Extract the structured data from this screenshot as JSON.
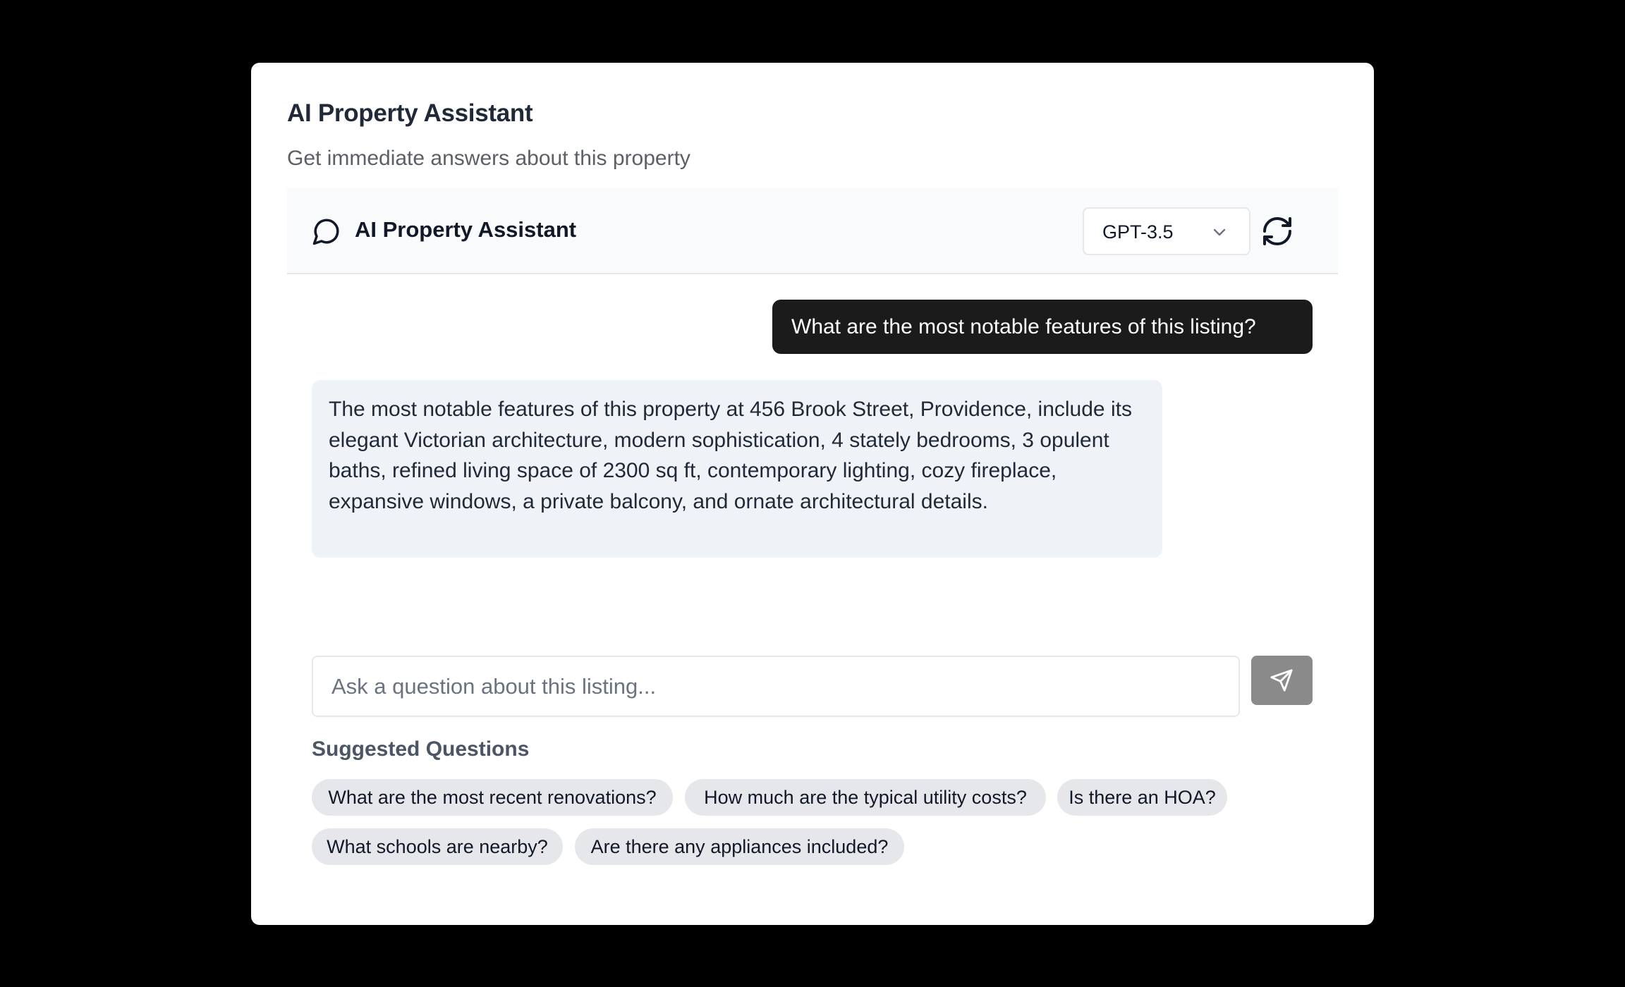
{
  "card": {
    "title": "AI Property Assistant",
    "subtitle": "Get immediate answers about this property"
  },
  "chat_header": {
    "title": "AI Property Assistant",
    "icon": "chat-bubble-icon",
    "model_select": {
      "selected": "GPT-3.5",
      "icon": "chevron-down-icon"
    },
    "refresh_icon": "refresh-icon"
  },
  "messages": [
    {
      "role": "user",
      "text": "What are the most notable features of this listing?"
    },
    {
      "role": "assistant",
      "text": "The most notable features of this property at 456 Brook Street, Providence, include its elegant Victorian architecture, modern sophistication, 4 stately bedrooms, 3 opulent baths, refined living space of 2300 sq ft, contemporary lighting, cozy fireplace, expansive windows, a private balcony, and ornate architectural details."
    }
  ],
  "composer": {
    "placeholder": "Ask a question about this listing...",
    "value": "",
    "send_icon": "send-icon"
  },
  "suggestions": {
    "title": "Suggested Questions",
    "items": [
      "What are the most recent renovations?",
      "How much are the typical utility costs?",
      "Is there an HOA?",
      "What schools are nearby?",
      "Are there any appliances included?"
    ]
  },
  "colors": {
    "page_background": "#000000",
    "card_background": "#ffffff",
    "user_bubble": "#1b1b1b",
    "assistant_bubble": "#eff3f8",
    "send_button": "#8a8a8a",
    "chip_background": "#e5e7eb"
  }
}
